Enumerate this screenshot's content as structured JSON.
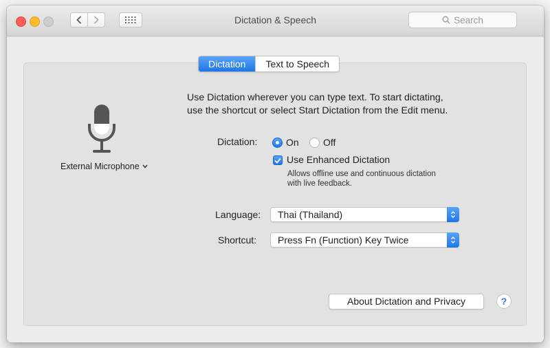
{
  "window": {
    "title": "Dictation & Speech"
  },
  "search": {
    "placeholder": "Search"
  },
  "tabs": [
    {
      "label": "Dictation",
      "active": true
    },
    {
      "label": "Text to Speech",
      "active": false
    }
  ],
  "microphone": {
    "label": "External Microphone",
    "icon": "microphone-icon"
  },
  "description": {
    "line1": "Use Dictation wherever you can type text. To start dictating,",
    "line2": "use the shortcut or select Start Dictation from the Edit menu."
  },
  "dictation": {
    "label": "Dictation:",
    "on_label": "On",
    "off_label": "Off",
    "selected": "On"
  },
  "enhanced": {
    "label": "Use Enhanced Dictation",
    "checked": true,
    "note_line1": "Allows offline use and continuous dictation",
    "note_line2": "with live feedback."
  },
  "language": {
    "label": "Language:",
    "value": "Thai (Thailand)"
  },
  "shortcut": {
    "label": "Shortcut:",
    "value": "Press Fn (Function) Key Twice"
  },
  "footer": {
    "about_label": "About Dictation and Privacy",
    "help_label": "?"
  },
  "colors": {
    "accent": "#1f76e6",
    "close": "#fd5e57",
    "minimize": "#fdbc2e",
    "zoom": "#cdcdcd"
  }
}
